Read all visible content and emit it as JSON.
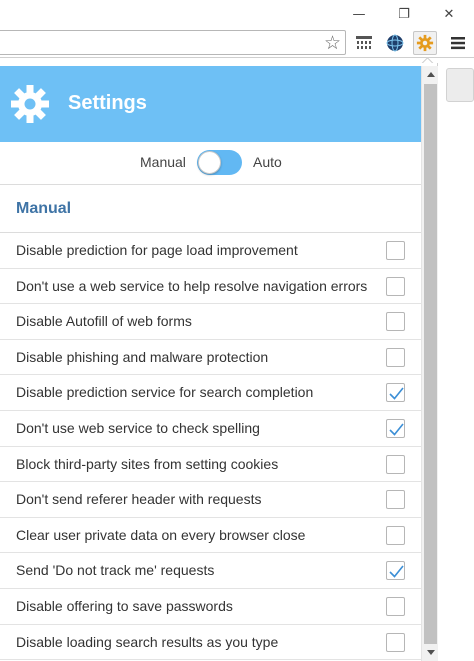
{
  "window": {
    "minimize_glyph": "—",
    "maximize_glyph": "❐",
    "close_glyph": "✕"
  },
  "toolbar": {
    "icons": [
      "bookmark-star-icon",
      "extension-grid-icon",
      "extension-globe-icon",
      "extension-gear-icon",
      "chrome-menu-icon"
    ]
  },
  "header": {
    "title": "Settings",
    "background_color": "#6ec0f5"
  },
  "mode": {
    "manual_label": "Manual",
    "auto_label": "Auto",
    "state": "manual",
    "toggle_color": "#62b8f3"
  },
  "section": {
    "title": "Manual",
    "title_color": "#3f74a6"
  },
  "options": [
    {
      "label": "Disable prediction for page load improvement",
      "checked": false
    },
    {
      "label": "Don't use a web service to help resolve navigation errors",
      "checked": false
    },
    {
      "label": "Disable Autofill of web forms",
      "checked": false
    },
    {
      "label": "Disable phishing and malware protection",
      "checked": false
    },
    {
      "label": "Disable prediction service for search completion",
      "checked": true
    },
    {
      "label": "Don't use web service to check spelling",
      "checked": true
    },
    {
      "label": "Block third-party sites from setting cookies",
      "checked": false
    },
    {
      "label": "Don't send referer header with requests",
      "checked": false
    },
    {
      "label": "Clear user private data on every browser close",
      "checked": false
    },
    {
      "label": "Send 'Do not track me' requests",
      "checked": true
    },
    {
      "label": "Disable offering to save passwords",
      "checked": false
    },
    {
      "label": "Disable loading search results as you type",
      "checked": false
    }
  ]
}
